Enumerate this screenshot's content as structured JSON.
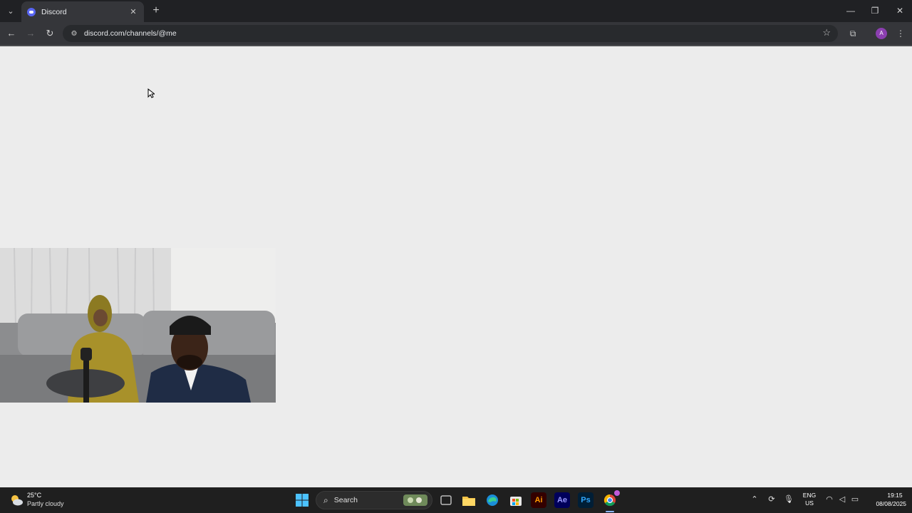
{
  "browser": {
    "tab": {
      "title": "Discord"
    },
    "url": "discord.com/channels/@me",
    "profile_initial": "A"
  },
  "window_controls": {
    "minimize": "—",
    "restore": "❐",
    "close": "✕"
  },
  "taskbar": {
    "weather": {
      "temperature": "25°C",
      "condition": "Partly cloudy"
    },
    "search_label": "Search",
    "language": {
      "line1": "ENG",
      "line2": "US"
    },
    "clock": {
      "time": "19:15",
      "date": "08/08/2025"
    },
    "pinned_apps": [
      "windows-start",
      "search",
      "task-view",
      "file-explorer",
      "edge",
      "microsoft-store",
      "illustrator",
      "after-effects",
      "photoshop",
      "chrome"
    ],
    "app_labels": {
      "illustrator": "Ai",
      "after_effects": "Ae",
      "photoshop": "Ps"
    }
  },
  "colors": {
    "discord_blurple": "#5865f2",
    "page_background": "#ececec",
    "taskbar": "#1f1f1f"
  }
}
